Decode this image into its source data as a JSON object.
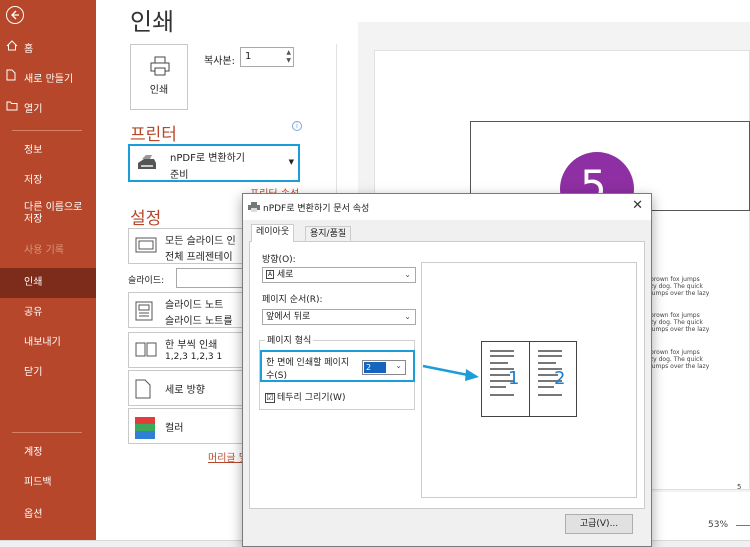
{
  "sidebar": {
    "items": [
      {
        "label": "홈"
      },
      {
        "label": "새로 만들기"
      },
      {
        "label": "열기"
      },
      {
        "label": "정보"
      },
      {
        "label": "저장"
      },
      {
        "label": "다른 이름으로 저장"
      },
      {
        "label": "사용 기록"
      },
      {
        "label": "인쇄"
      },
      {
        "label": "공유"
      },
      {
        "label": "내보내기"
      },
      {
        "label": "닫기"
      },
      {
        "label": "계정"
      },
      {
        "label": "피드백"
      },
      {
        "label": "옵션"
      }
    ],
    "active": "인쇄",
    "color": "#b7472a",
    "active_color": "#7d2b1a"
  },
  "main": {
    "title": "인쇄",
    "print_button": "인쇄",
    "copies_label": "복사본:",
    "copies_value": "1",
    "printer_heading": "프린터",
    "printer_name": "nPDF로 변환하기",
    "printer_status": "준비",
    "printer_properties": "프린터 속성",
    "settings_heading": "설정",
    "settings": [
      {
        "line1": "모든 슬라이드 인",
        "line2": "전체 프레젠테이"
      },
      {
        "line1": "슬라이드 노트",
        "line2": "슬라이드 노트를"
      },
      {
        "line1": "한 부씩 인쇄",
        "line2": "1,2,3    1,2,3    1"
      },
      {
        "line1": "세로 방향",
        "line2": ""
      },
      {
        "line1": "컬러",
        "line2": ""
      }
    ],
    "slides_label": "슬라이드:",
    "edit_header": "머리글 및"
  },
  "preview": {
    "slide_number": "5",
    "text_lines": [
      "brown fox jumps",
      "zy dog. The quick",
      "jumps over the lazy",
      "brown fox jumps",
      "zy dog. The quick",
      "jumps over the lazy",
      "brown fox jumps",
      "zy dog. The quick",
      "jumps over the lazy"
    ],
    "page_number": "5",
    "zoom": "53%"
  },
  "dialog": {
    "title": "nPDF로 변환하기 문서 속성",
    "tabs": [
      "레이아웃",
      "용지/품질"
    ],
    "orientation_label": "방향(O):",
    "orientation_value": "세로",
    "page_order_label": "페이지 순서(R):",
    "page_order_value": "앞에서 뒤로",
    "page_format_label": "페이지 형식",
    "pages_per_sheet_line1": "한 면에 인쇄할 페이지",
    "pages_per_sheet_line2": "수(S)",
    "pages_per_sheet_value": "2",
    "draw_borders_label": "테두리 그리기(W)",
    "draw_borders_checked": "☑",
    "preview_pages": [
      "1",
      "2"
    ],
    "advanced_button": "고급(V)...",
    "highlight_color": "#1a9ed9"
  }
}
